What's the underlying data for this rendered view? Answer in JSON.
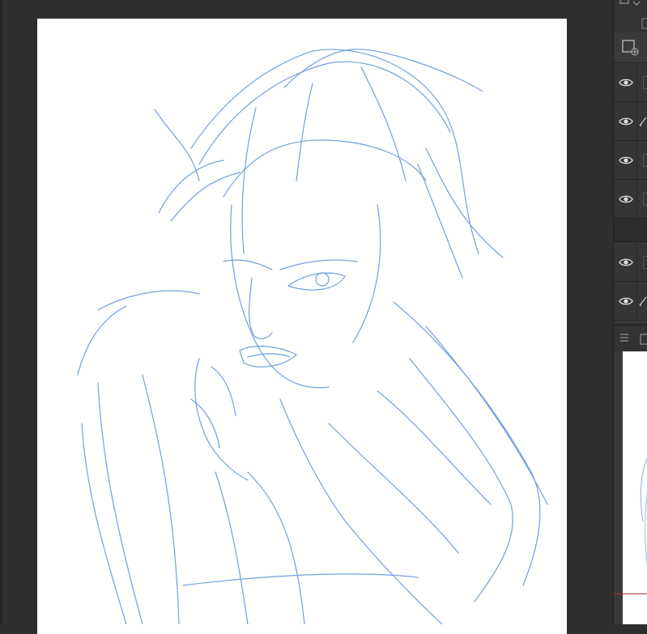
{
  "app": {
    "canvas": {
      "background": "#ffffff",
      "line_color": "#5a8fd6"
    },
    "workspace_bg": "#2f2f2f"
  },
  "layers_panel": {
    "icons": [
      "new-layer-icon",
      "folder-icon",
      "menu-icon",
      "copy-icon"
    ],
    "rows": [
      {
        "visible": true,
        "icon": "eye-icon",
        "edit": false
      },
      {
        "visible": true,
        "icon": "eye-icon",
        "edit": true
      },
      {
        "visible": true,
        "icon": "eye-icon",
        "edit": false
      },
      {
        "visible": true,
        "icon": "eye-icon",
        "edit": false
      },
      {
        "visible": true,
        "icon": "eye-icon",
        "edit": false
      },
      {
        "visible": true,
        "icon": "eye-icon",
        "edit": true
      }
    ]
  },
  "navigator": {
    "preview": "sketch-thumbnail"
  }
}
